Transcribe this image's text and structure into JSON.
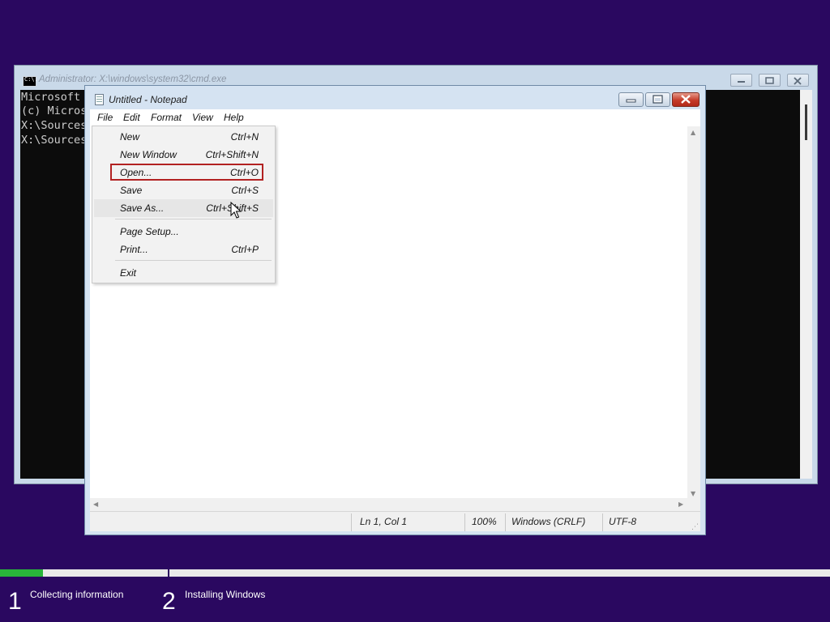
{
  "cmd": {
    "title": "Administrator: X:\\windows\\system32\\cmd.exe",
    "icon_text": "C:\\.",
    "lines": [
      "Microsoft",
      "(c) Micros",
      "",
      "X:\\Sources",
      "",
      "X:\\Sources"
    ]
  },
  "notepad": {
    "title": "Untitled - Notepad",
    "menu": [
      "File",
      "Edit",
      "Format",
      "View",
      "Help"
    ],
    "status": {
      "position": "Ln 1, Col 1",
      "zoom": "100%",
      "line_ending": "Windows (CRLF)",
      "encoding": "UTF-8"
    }
  },
  "file_menu": {
    "items": [
      {
        "label": "New",
        "shortcut": "Ctrl+N"
      },
      {
        "label": "New Window",
        "shortcut": "Ctrl+Shift+N"
      },
      {
        "label": "Open...",
        "shortcut": "Ctrl+O",
        "outlined": true
      },
      {
        "label": "Save",
        "shortcut": "Ctrl+S"
      },
      {
        "label": "Save As...",
        "shortcut": "Ctrl+Shift+S",
        "hovered": true
      },
      {
        "label": "Page Setup...",
        "shortcut": ""
      },
      {
        "label": "Print...",
        "shortcut": "Ctrl+P"
      },
      {
        "label": "Exit",
        "shortcut": ""
      }
    ]
  },
  "setup": {
    "steps": [
      {
        "number": "1",
        "label": "Collecting information"
      },
      {
        "number": "2",
        "label": "Installing Windows"
      }
    ],
    "progress_fraction": 0.052
  },
  "colors": {
    "desktop": "#2a0860",
    "progress": "#29b53a",
    "open_outline": "#b22222"
  }
}
